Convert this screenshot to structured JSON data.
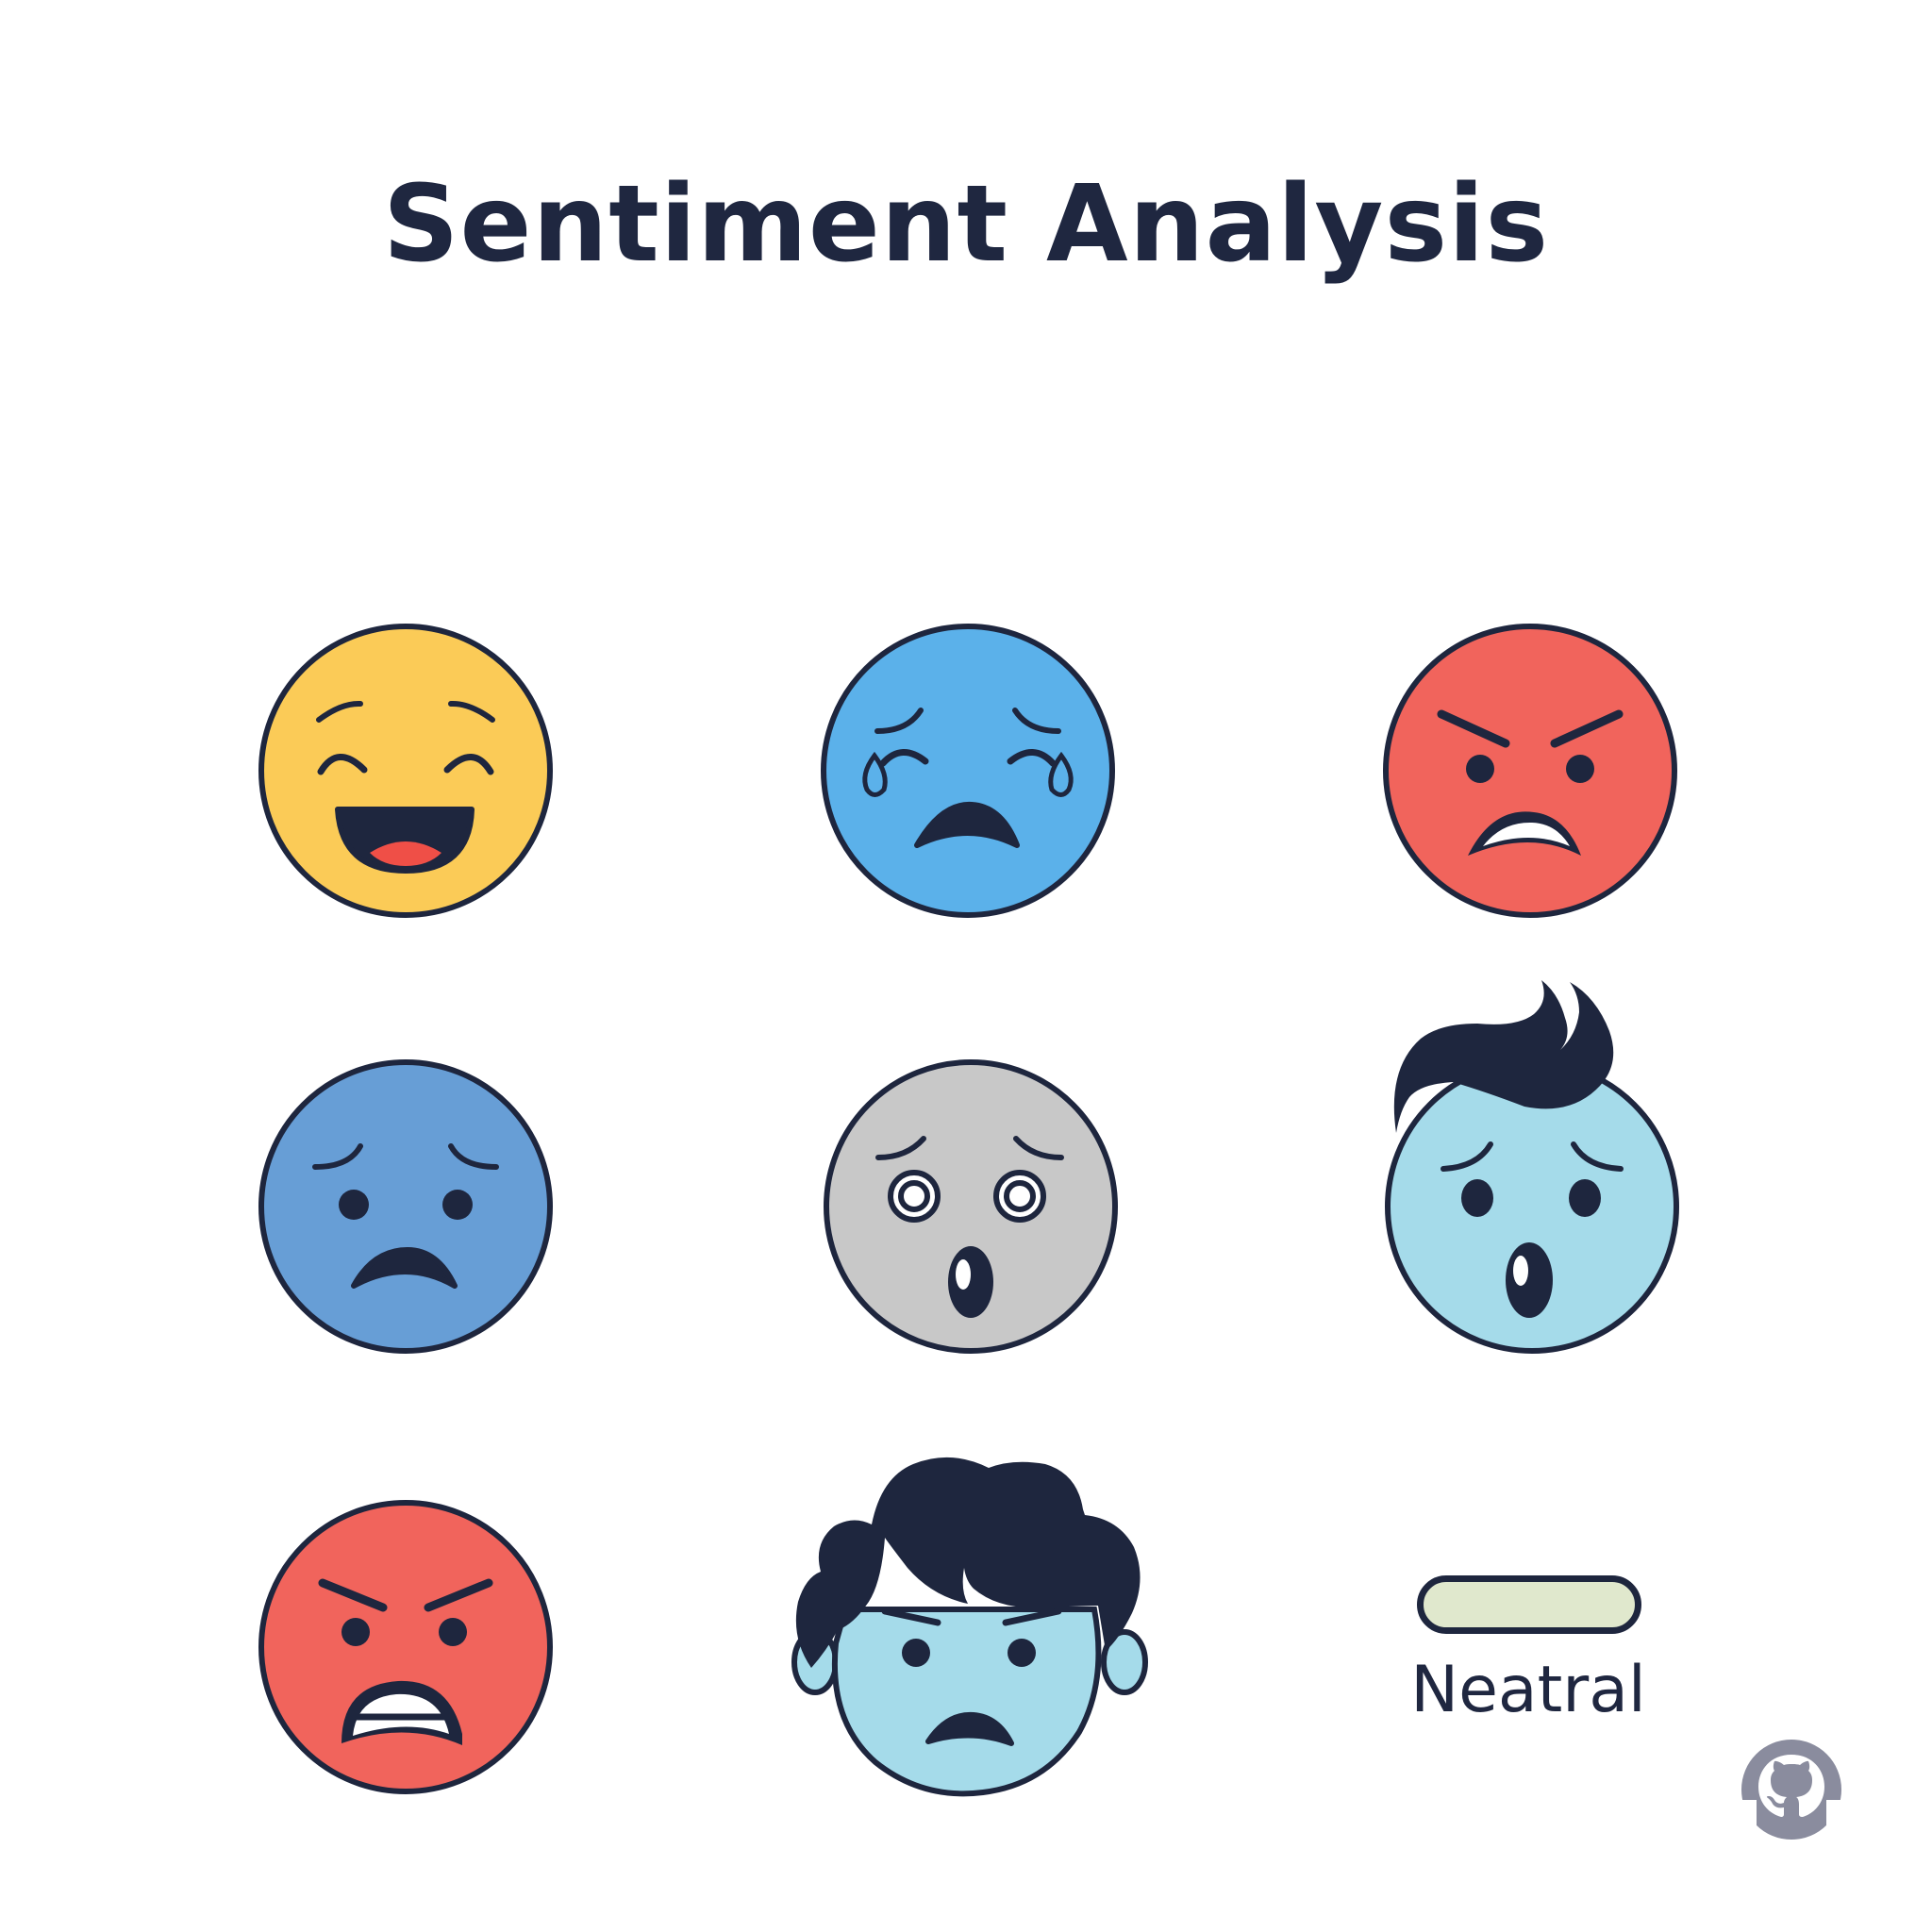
{
  "title": "Sentiment Analysis",
  "faces": [
    {
      "name": "laughing-face",
      "color": "#fbcb57"
    },
    {
      "name": "crying-face",
      "color": "#5bb1ea"
    },
    {
      "name": "angry-face",
      "color": "#f1645c"
    },
    {
      "name": "sad-face",
      "color": "#679ed6"
    },
    {
      "name": "surprised-face",
      "color": "#c8c8c8"
    },
    {
      "name": "surprised-face-with-hair",
      "color": "#a5dbea"
    },
    {
      "name": "angry-face",
      "color": "#f1645c"
    },
    {
      "name": "grumpy-face-with-hair",
      "color": "#a5dbea"
    }
  ],
  "status": {
    "label": "Neatral",
    "bar_color": "#e0e8cd"
  },
  "colors": {
    "outline": "#1e263e",
    "text": "#1f2740"
  },
  "icons": {
    "corner": "github-icon"
  }
}
